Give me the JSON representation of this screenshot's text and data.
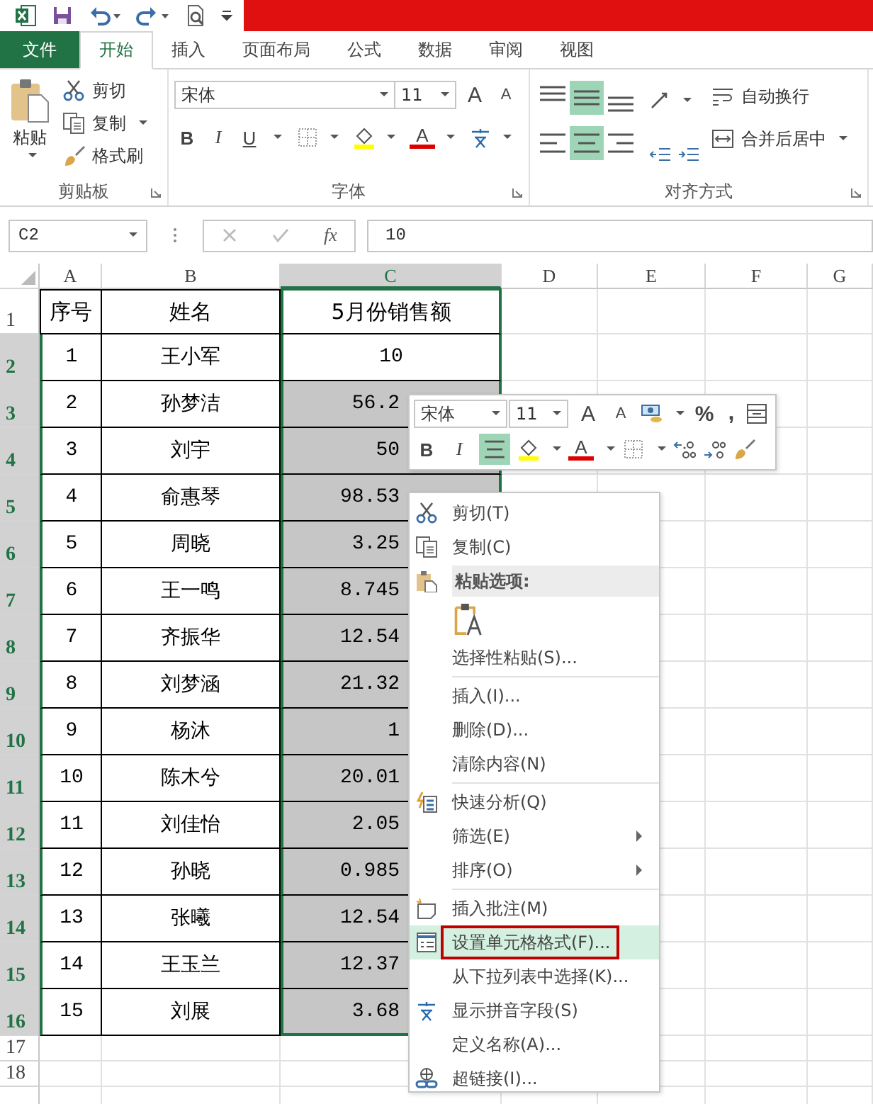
{
  "tabs": [
    {
      "label": "文件",
      "kind": "file",
      "selected": false
    },
    {
      "label": "开始",
      "kind": "tab",
      "selected": true
    },
    {
      "label": "插入",
      "kind": "tab",
      "selected": false
    },
    {
      "label": "页面布局",
      "kind": "tab",
      "selected": false
    },
    {
      "label": "公式",
      "kind": "tab",
      "selected": false
    },
    {
      "label": "数据",
      "kind": "tab",
      "selected": false
    },
    {
      "label": "审阅",
      "kind": "tab",
      "selected": false
    },
    {
      "label": "视图",
      "kind": "tab",
      "selected": false
    }
  ],
  "ribbon": {
    "clipboard": {
      "paste": "粘贴",
      "cut": "剪切",
      "copy": "复制",
      "format_painter": "格式刷",
      "label": "剪贴板"
    },
    "font": {
      "name": "宋体",
      "size": "11",
      "grow": "A",
      "shrink": "A",
      "bold": "B",
      "italic": "I",
      "underline": "U",
      "font_color": "A",
      "label": "字体"
    },
    "alignment": {
      "buttons": [
        {
          "kind": "top",
          "selected": false
        },
        {
          "kind": "middle",
          "selected": true
        },
        {
          "kind": "bottom",
          "selected": false
        },
        {
          "kind": "left",
          "selected": false
        },
        {
          "kind": "center",
          "selected": true
        },
        {
          "kind": "right",
          "selected": false
        }
      ],
      "wrap": "自动换行",
      "merge": "合并后居中",
      "label": "对齐方式"
    }
  },
  "formula_bar": {
    "name_box": "C2",
    "fx": "fx",
    "value": "10"
  },
  "sheet": {
    "columns": [
      {
        "label": "A",
        "selected": false
      },
      {
        "label": "B",
        "selected": false
      },
      {
        "label": "C",
        "selected": true
      },
      {
        "label": "D",
        "selected": false
      },
      {
        "label": "E",
        "selected": false
      },
      {
        "label": "F",
        "selected": false
      },
      {
        "label": "G",
        "selected": false
      }
    ],
    "header_row": {
      "num": "1",
      "cells": [
        "序号",
        "姓名",
        "5月份销售额"
      ]
    },
    "rows": [
      {
        "num": "2",
        "selected": true,
        "no": "1",
        "name": "王小军",
        "sales": "10",
        "sales_selected": false
      },
      {
        "num": "3",
        "selected": true,
        "no": "2",
        "name": "孙梦洁",
        "sales": "56.2",
        "sales_selected": true
      },
      {
        "num": "4",
        "selected": true,
        "no": "3",
        "name": "刘宇",
        "sales": "50",
        "sales_selected": true
      },
      {
        "num": "5",
        "selected": true,
        "no": "4",
        "name": "俞惠琴",
        "sales": "98.53",
        "sales_selected": true
      },
      {
        "num": "6",
        "selected": true,
        "no": "5",
        "name": "周晓",
        "sales": "3.25",
        "sales_selected": true
      },
      {
        "num": "7",
        "selected": true,
        "no": "6",
        "name": "王一鸣",
        "sales": "8.745",
        "sales_selected": true
      },
      {
        "num": "8",
        "selected": true,
        "no": "7",
        "name": "齐振华",
        "sales": "12.54",
        "sales_selected": true
      },
      {
        "num": "9",
        "selected": true,
        "no": "8",
        "name": "刘梦涵",
        "sales": "21.32",
        "sales_selected": true
      },
      {
        "num": "10",
        "selected": true,
        "no": "9",
        "name": "杨沐",
        "sales": "1",
        "sales_selected": true
      },
      {
        "num": "11",
        "selected": true,
        "no": "10",
        "name": "陈木兮",
        "sales": "20.01",
        "sales_selected": true
      },
      {
        "num": "12",
        "selected": true,
        "no": "11",
        "name": "刘佳怡",
        "sales": "2.05",
        "sales_selected": true
      },
      {
        "num": "13",
        "selected": true,
        "no": "12",
        "name": "孙晓",
        "sales": "0.985",
        "sales_selected": true
      },
      {
        "num": "14",
        "selected": true,
        "no": "13",
        "name": "张曦",
        "sales": "12.54",
        "sales_selected": true
      },
      {
        "num": "15",
        "selected": true,
        "no": "14",
        "name": "王玉兰",
        "sales": "12.37",
        "sales_selected": true
      },
      {
        "num": "16",
        "selected": true,
        "no": "15",
        "name": "刘展",
        "sales": "3.68",
        "sales_selected": true
      }
    ],
    "empty_rows": [
      "17",
      "18"
    ]
  },
  "mini_toolbar": {
    "font": "宋体",
    "size": "11",
    "grow": "A",
    "shrink": "A",
    "percent": "%",
    "comma": ",",
    "bold": "B",
    "italic": "I",
    "center_selected": true,
    "font_color": "A"
  },
  "context_menu": {
    "items": [
      {
        "kind": "item",
        "label": "剪切(T)",
        "submenu": false,
        "selected": false,
        "outlined": false
      },
      {
        "kind": "item",
        "label": "复制(C)",
        "submenu": false,
        "selected": false,
        "outlined": false
      },
      {
        "kind": "header",
        "label": "粘贴选项:"
      },
      {
        "kind": "paste"
      },
      {
        "kind": "item",
        "label": "选择性粘贴(S)...",
        "submenu": false,
        "selected": false,
        "outlined": false
      },
      {
        "kind": "separator"
      },
      {
        "kind": "item",
        "label": "插入(I)...",
        "submenu": false,
        "selected": false,
        "outlined": false
      },
      {
        "kind": "item",
        "label": "删除(D)...",
        "submenu": false,
        "selected": false,
        "outlined": false
      },
      {
        "kind": "item",
        "label": "清除内容(N)",
        "submenu": false,
        "selected": false,
        "outlined": false
      },
      {
        "kind": "separator"
      },
      {
        "kind": "item",
        "label": "快速分析(Q)",
        "submenu": false,
        "selected": false,
        "outlined": false
      },
      {
        "kind": "item",
        "label": "筛选(E)",
        "submenu": true,
        "selected": false,
        "outlined": false
      },
      {
        "kind": "item",
        "label": "排序(O)",
        "submenu": true,
        "selected": false,
        "outlined": false
      },
      {
        "kind": "separator"
      },
      {
        "kind": "item",
        "label": "插入批注(M)",
        "submenu": false,
        "selected": false,
        "outlined": false
      },
      {
        "kind": "item",
        "label": "设置单元格格式(F)...",
        "submenu": false,
        "selected": true,
        "outlined": true
      },
      {
        "kind": "item",
        "label": "从下拉列表中选择(K)...",
        "submenu": false,
        "selected": false,
        "outlined": false
      },
      {
        "kind": "item",
        "label": "显示拼音字段(S)",
        "submenu": false,
        "selected": false,
        "outlined": false
      },
      {
        "kind": "item",
        "label": "定义名称(A)...",
        "submenu": false,
        "selected": false,
        "outlined": false
      },
      {
        "kind": "item",
        "label": "超链接(I)...",
        "submenu": false,
        "selected": false,
        "outlined": false
      }
    ]
  }
}
